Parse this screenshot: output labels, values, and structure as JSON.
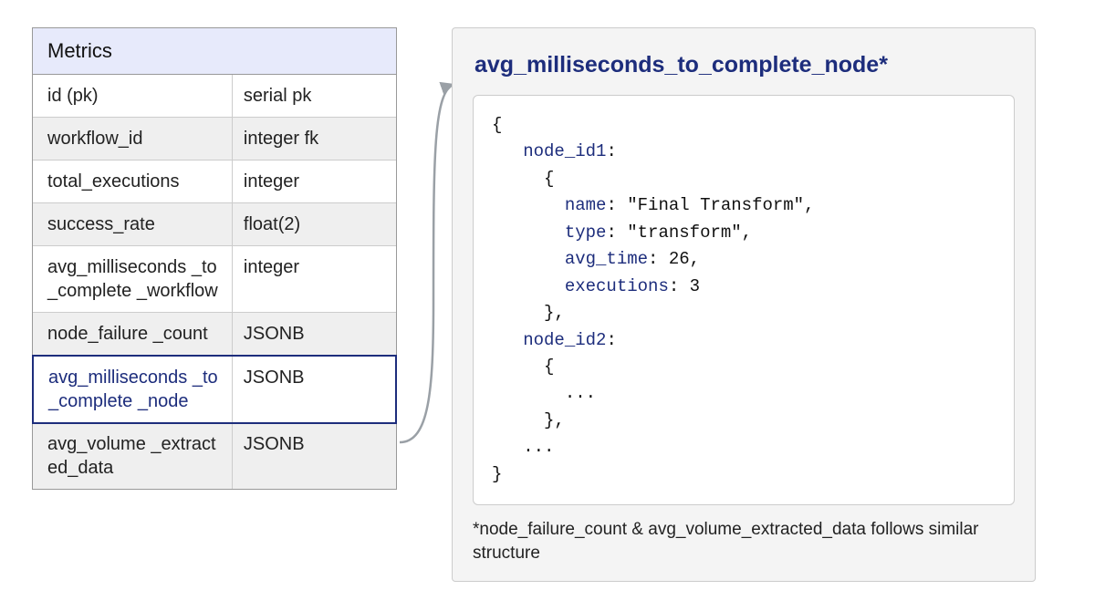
{
  "table": {
    "title": "Metrics",
    "rows": [
      {
        "name": "id (pk)",
        "type": "serial pk"
      },
      {
        "name": "workflow_id",
        "type": "integer fk"
      },
      {
        "name": "total_executions",
        "type": "integer"
      },
      {
        "name": "success_rate",
        "type": "float(2)"
      },
      {
        "name": "avg_milliseconds\n_to_complete\n_workflow",
        "type": "integer"
      },
      {
        "name": "node_failure\n_count",
        "type": "JSONB"
      },
      {
        "name": "avg_milliseconds\n_to_complete\n_node",
        "type": "JSONB"
      },
      {
        "name": "avg_volume\n_extracted_data",
        "type": "JSONB"
      }
    ],
    "highlight_index": 6
  },
  "detail": {
    "title": "avg_milliseconds_to_complete_node*",
    "code": {
      "open": "{",
      "k_node1": "node_id1",
      "colon": ":",
      "open2": "{",
      "k_name": "name",
      "v_name": "\"Final Transform\"",
      "k_type": "type",
      "v_type": "\"transform\"",
      "k_avg": "avg_time",
      "v_avg": "26",
      "k_exec": "executions",
      "v_exec": "3",
      "close2": "},",
      "k_node2": "node_id2",
      "open3": "{",
      "ell": "...",
      "close3": "},",
      "ell2": "...",
      "close": "}"
    },
    "footnote": "*node_failure_count & avg_volume_extracted_data follows similar structure"
  }
}
